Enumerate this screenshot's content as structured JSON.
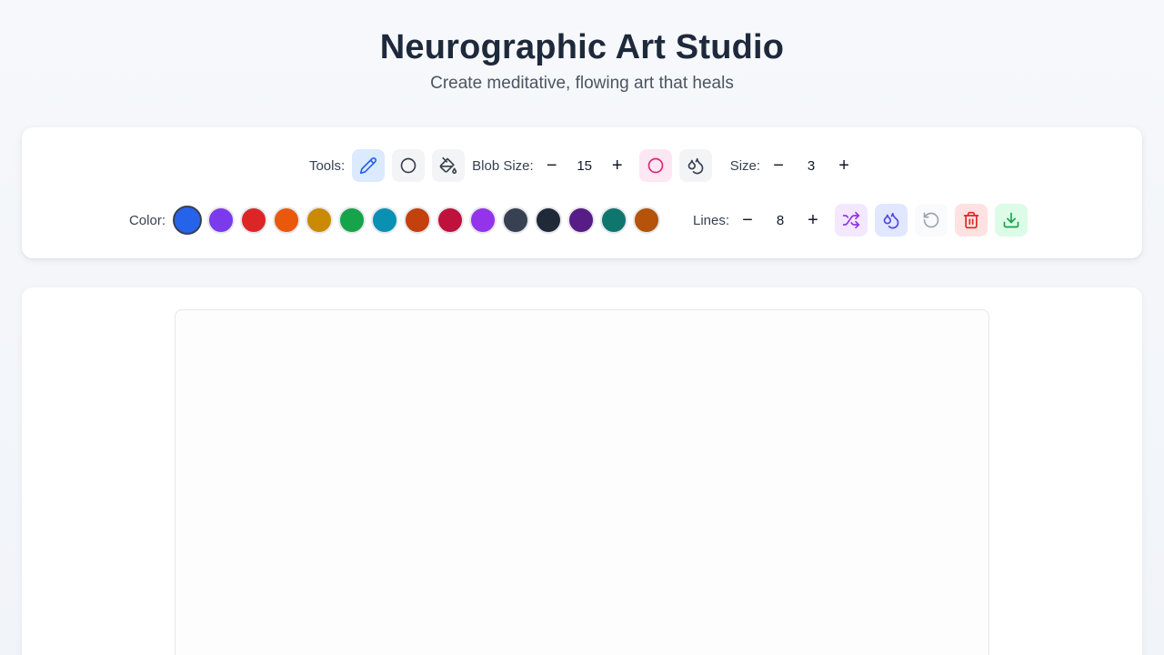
{
  "app": {
    "title": "Neurographic Art Studio",
    "subtitle": "Create meditative, flowing art that heals"
  },
  "toolbar": {
    "tools_label": "Tools:",
    "tools": [
      {
        "name": "pencil",
        "icon": "pencil-icon",
        "active": true
      },
      {
        "name": "circle",
        "icon": "circle-icon",
        "active": false
      },
      {
        "name": "fill",
        "icon": "paint-bucket-icon",
        "active": false
      }
    ],
    "blob_size_label": "Blob Size:",
    "blob_size_value": "15",
    "blob_circle_icon": "circle-icon",
    "blob_drops_icon": "droplets-icon",
    "size_label": "Size:",
    "size_value": "3",
    "minus": "−",
    "plus": "+",
    "color_label": "Color:",
    "colors": [
      "#2563eb",
      "#7c3aed",
      "#dc2626",
      "#ea580c",
      "#ca8a04",
      "#16a34a",
      "#0891b2",
      "#c2410c",
      "#be123c",
      "#9333ea",
      "#374151",
      "#1f2937",
      "#581c87",
      "#0f766e",
      "#b45309"
    ],
    "selected_color": "#2563eb",
    "lines_label": "Lines:",
    "lines_value": "8",
    "actions": [
      {
        "name": "shuffle",
        "icon": "shuffle-icon"
      },
      {
        "name": "droplets",
        "icon": "droplets-icon"
      },
      {
        "name": "undo",
        "icon": "undo-icon"
      },
      {
        "name": "clear",
        "icon": "trash-icon"
      },
      {
        "name": "download",
        "icon": "download-icon"
      }
    ]
  }
}
